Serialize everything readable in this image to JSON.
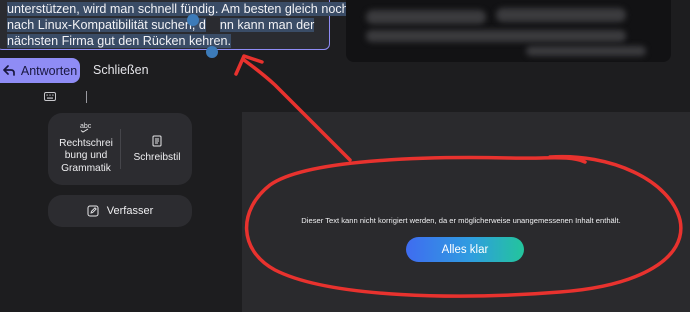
{
  "compose": {
    "line1": "unterstützen, wird man schnell fündig. Am besten gleich noch",
    "line2_a": "nach Linux-Kompatibilität suchen,  d",
    "line2_b": "nn kann man der",
    "line3": "nächsten Firma gut den Rücken kehren."
  },
  "actions": {
    "reply_label": "Antworten",
    "close_label": "Schließen"
  },
  "tools": {
    "spelling_label_1": "Rechtschrei",
    "spelling_label_2": "bung und",
    "spelling_label_3": "Grammatik",
    "style_label": "Schreibstil",
    "author_label": "Verfasser"
  },
  "dialog": {
    "message": "Dieser Text kann nicht korrigiert werden, da er möglicherweise unangemessenen Inhalt enthält.",
    "ok_label": "Alles klar"
  },
  "colors": {
    "accent": "#8f8cf5",
    "annotation": "#e8322e",
    "button_gradient_start": "#3f6cf0",
    "button_gradient_end": "#23c59c"
  }
}
